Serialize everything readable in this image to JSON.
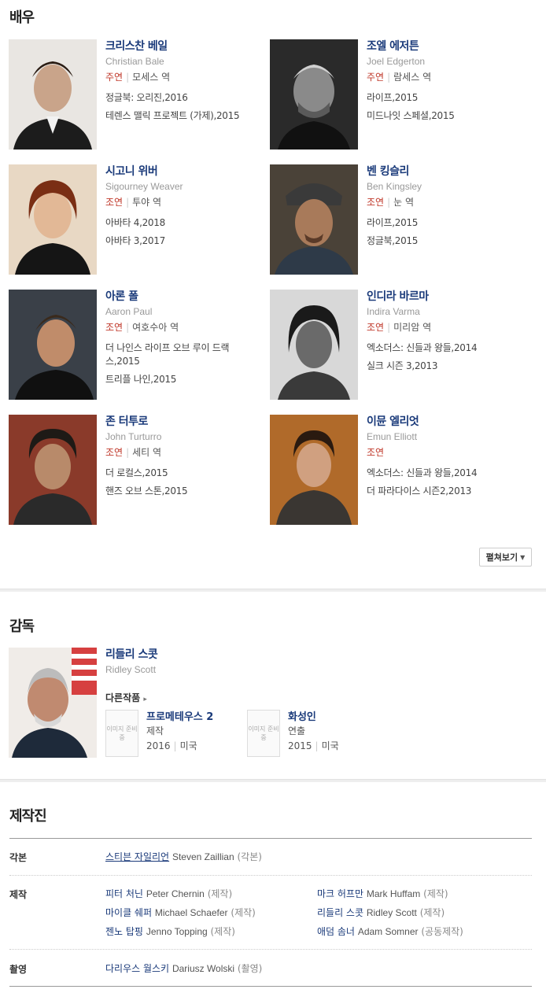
{
  "cast": {
    "title": "배우",
    "actors": [
      {
        "name_ko": "크리스찬 베일",
        "name_en": "Christian Bale",
        "role_type": "주연",
        "role": "모세스 역",
        "works": [
          "정글북: 오리진,2016",
          "테렌스 맬릭 프로젝트 (가제),2015"
        ]
      },
      {
        "name_ko": "조엘 에저튼",
        "name_en": "Joel Edgerton",
        "role_type": "주연",
        "role": "람세스 역",
        "works": [
          "라이프,2015",
          "미드나잇 스페셜,2015"
        ]
      },
      {
        "name_ko": "시고니 위버",
        "name_en": "Sigourney Weaver",
        "role_type": "조연",
        "role": "투야 역",
        "works": [
          "아바타 4,2018",
          "아바타 3,2017"
        ]
      },
      {
        "name_ko": "벤 킹슬리",
        "name_en": "Ben Kingsley",
        "role_type": "조연",
        "role": "눈 역",
        "works": [
          "라이프,2015",
          "정글북,2015"
        ]
      },
      {
        "name_ko": "아론 폴",
        "name_en": "Aaron Paul",
        "role_type": "조연",
        "role": "여호수아 역",
        "works": [
          "더 나인스 라이프 오브 루이 드랙스,2015",
          "트리플 나인,2015"
        ]
      },
      {
        "name_ko": "인디라 바르마",
        "name_en": "Indira Varma",
        "role_type": "조연",
        "role": "미리암 역",
        "works": [
          "엑소더스: 신들과 왕들,2014",
          "실크 시즌 3,2013"
        ]
      },
      {
        "name_ko": "존 터투로",
        "name_en": "John Turturro",
        "role_type": "조연",
        "role": "세티 역",
        "works": [
          "더 로컬스,2015",
          "핸즈 오브 스톤,2015"
        ]
      },
      {
        "name_ko": "이뮨 엘리엇",
        "name_en": "Emun Elliott",
        "role_type": "조연",
        "role": "",
        "works": [
          "엑소더스: 신들과 왕들,2014",
          "더 파라다이스 시즌2,2013"
        ]
      }
    ],
    "expand_label": "펼쳐보기"
  },
  "director": {
    "title": "감독",
    "name_ko": "리들리 스콧",
    "name_en": "Ridley Scott",
    "other_works_label": "다른작품",
    "placeholder_text": "이미지 준비중",
    "works": [
      {
        "title": "프로메테우스 2",
        "role": "제작",
        "year": "2016",
        "country": "미국"
      },
      {
        "title": "화성인",
        "role": "연출",
        "year": "2015",
        "country": "미국"
      }
    ]
  },
  "crew": {
    "title": "제작진",
    "groups": [
      {
        "label": "각본",
        "people": [
          {
            "ko": "스티븐 자일리언",
            "en": "Steven Zaillian",
            "role": "(각본)"
          }
        ]
      },
      {
        "label": "제작",
        "people": [
          {
            "ko": "피터 처닌",
            "en": "Peter Chernin",
            "role": "(제작)"
          },
          {
            "ko": "마크 허프만",
            "en": "Mark Huffam",
            "role": "(제작)"
          },
          {
            "ko": "마이클 쉐퍼",
            "en": "Michael Schaefer",
            "role": "(제작)"
          },
          {
            "ko": "리들리 스콧",
            "en": "Ridley Scott",
            "role": "(제작)"
          },
          {
            "ko": "젠노 탑핑",
            "en": "Jenno Topping",
            "role": "(제작)"
          },
          {
            "ko": "애덤 솜너",
            "en": "Adam Somner",
            "role": "(공동제작)"
          }
        ]
      },
      {
        "label": "촬영",
        "people": [
          {
            "ko": "다리우스 월스키",
            "en": "Dariusz Wolski",
            "role": "(촬영)"
          }
        ]
      }
    ]
  },
  "colors": {
    "link": "#1a3a7a",
    "role_type": "#c0392b",
    "muted": "#999999"
  },
  "icons": {
    "caret": "caret-down-icon",
    "arrow": "chevron-right-icon"
  }
}
